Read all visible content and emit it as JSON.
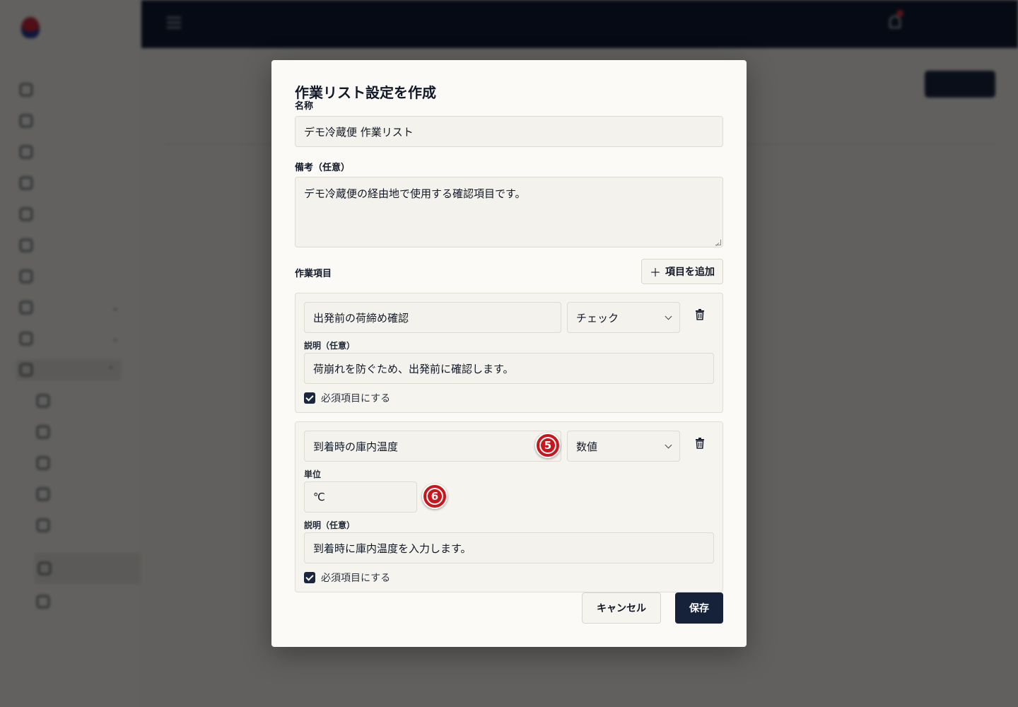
{
  "modal": {
    "title": "作業リスト設定を作成",
    "name_label": "名称",
    "name_value": "デモ冷蔵便 作業リスト",
    "memo_label": "備考（任意）",
    "memo_value": "デモ冷蔵便の経由地で使用する確認項目です。",
    "items_label": "作業項目",
    "add_item_label": "項目を追加",
    "items": [
      {
        "name": "出発前の荷締め確認",
        "type": "チェック",
        "description_label": "説明（任意）",
        "description": "荷崩れを防ぐため、出発前に確認します。",
        "required_label": "必須項目にする",
        "required": true
      },
      {
        "name": "到着時の庫内温度",
        "type": "数値",
        "unit_label": "単位",
        "unit": "℃",
        "description_label": "説明（任意）",
        "description": "到着時に庫内温度を入力します。",
        "required_label": "必須項目にする",
        "required": true
      }
    ],
    "cancel_label": "キャンセル",
    "save_label": "保存"
  },
  "markers": [
    "5",
    "6"
  ],
  "colors": {
    "primary": "#16213a",
    "marker": "#c9161c",
    "overlay": "rgba(0,0,0,0.6)"
  }
}
